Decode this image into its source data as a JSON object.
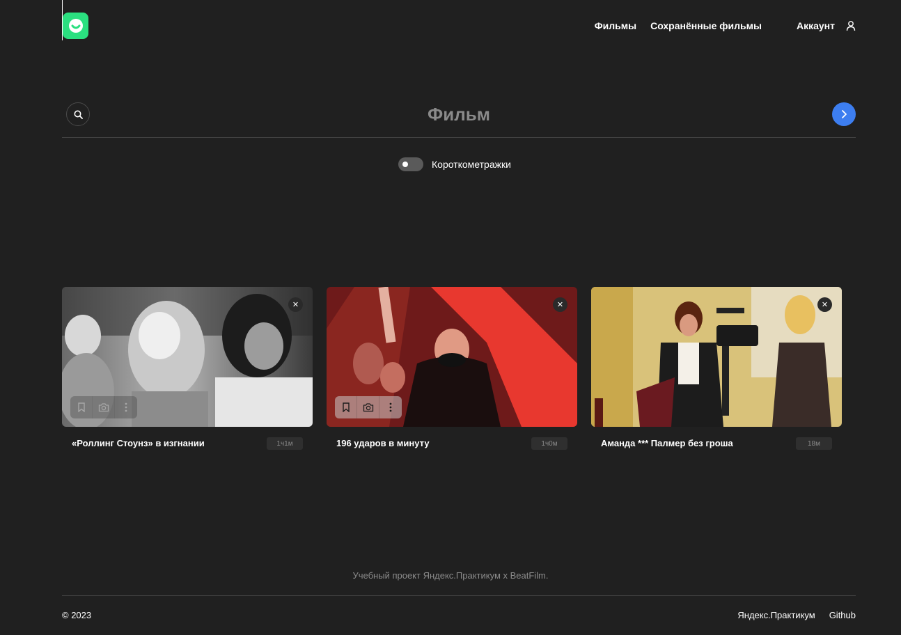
{
  "header": {
    "nav": {
      "movies": "Фильмы",
      "saved_movies": "Сохранённые фильмы",
      "account": "Аккаунт"
    },
    "icons": {
      "logo": "smile-logo-icon",
      "account": "person-icon"
    }
  },
  "search": {
    "placeholder": "Фильм",
    "value": "",
    "icons": {
      "search": "search-icon",
      "submit": "chevron-right-icon"
    }
  },
  "filter": {
    "label": "Короткометражки",
    "enabled": false
  },
  "cards": [
    {
      "title": "«Роллинг Стоунз» в изгнании",
      "duration": "1ч1м"
    },
    {
      "title": "196 ударов в минуту",
      "duration": "1ч0м"
    },
    {
      "title": "Аманда *** Палмер без гроша",
      "duration": "18м"
    }
  ],
  "card_icons": {
    "remove": "close-icon",
    "save": "bookmark-icon",
    "camera": "camera-icon",
    "more": "more-vertical-icon"
  },
  "footer": {
    "caption": "Учебный проект Яндекс.Практикум х BeatFilm.",
    "copyright": "© 2023",
    "links": [
      "Яндекс.Практикум",
      "Github"
    ]
  },
  "colors": {
    "background": "#202020",
    "accent_green": "#2be080",
    "accent_blue": "#3d7ef0"
  }
}
